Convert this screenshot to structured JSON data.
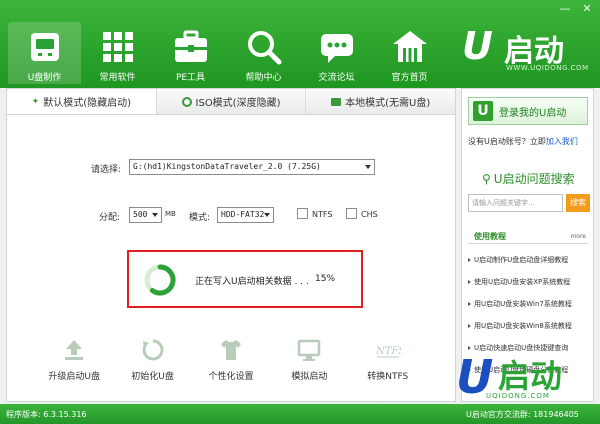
{
  "window_controls": [
    "—",
    "✕"
  ],
  "nav": [
    {
      "label": "U盘制作",
      "icon": "usb-drive-icon",
      "active": true
    },
    {
      "label": "常用软件",
      "icon": "app-grid-icon",
      "active": false
    },
    {
      "label": "PE工具",
      "icon": "toolbox-icon",
      "active": false
    },
    {
      "label": "帮助中心",
      "icon": "magnifier-icon",
      "active": false
    },
    {
      "label": "交流论坛",
      "icon": "chat-bubble-icon",
      "active": false
    },
    {
      "label": "官方首页",
      "icon": "home-icon",
      "active": false
    }
  ],
  "brand": {
    "mark": "U",
    "title": "启动",
    "url": "WWW.UQIDONG.COM"
  },
  "tabs": [
    {
      "label": "默认模式(隐藏启动)",
      "active": true
    },
    {
      "label": "ISO模式(深度隐藏)",
      "active": false
    },
    {
      "label": "本地模式(无需U盘)",
      "active": false
    }
  ],
  "form": {
    "select_label": "请选择:",
    "device": "G:(hd1)KingstonDataTraveler_2.0 (7.25G)",
    "partition_label": "分配:",
    "partition_value": "500",
    "partition_unit": "MB",
    "mode_label": "模式:",
    "mode_value": "HDD-FAT32",
    "ntfs_label": "NTFS",
    "chs_label": "CHS"
  },
  "progress": {
    "message": "正在写入U启动相关数据 . . .",
    "percent_text": "15%",
    "percent": 15
  },
  "tools": [
    {
      "label": "升级启动U盘",
      "icon": "upgrade-icon"
    },
    {
      "label": "初始化U盘",
      "icon": "reset-icon"
    },
    {
      "label": "个性化设置",
      "icon": "shirt-icon"
    },
    {
      "label": "模拟启动",
      "icon": "monitor-icon"
    },
    {
      "label": "转换NTFS",
      "icon": "ntfs-icon"
    }
  ],
  "right": {
    "login_label": "登录我的U启动",
    "no_account": "没有U启动账号？立即",
    "join_link": "加入我们",
    "search_title": "U启动问题搜索",
    "search_placeholder": "请输入问题关键字...",
    "search_button": "搜索",
    "tutorials_title": "使用教程",
    "more": "more",
    "tutorials": [
      "U启动制作U盘启动盘详细教程",
      "使用U启动U盘安装XP系统教程",
      "用U启动U盘安装Win7系统教程",
      "用U启动U盘安装Win8系统教程",
      "U启动快速启动U盘快捷键查询",
      "使用U启动U盘给硬盘分区教程"
    ]
  },
  "watermark": {
    "mark": "U",
    "text": "启动",
    "url": "UQIDONG.COM"
  },
  "status": {
    "version": "程序版本: 6.3.15.316",
    "qq_group": "U启动官方交流群: 181946405"
  },
  "colors": {
    "brand_green": "#2aa336",
    "alert_red": "#e02020",
    "link_blue": "#1a5fd0",
    "search_orange": "#f39b1b"
  }
}
